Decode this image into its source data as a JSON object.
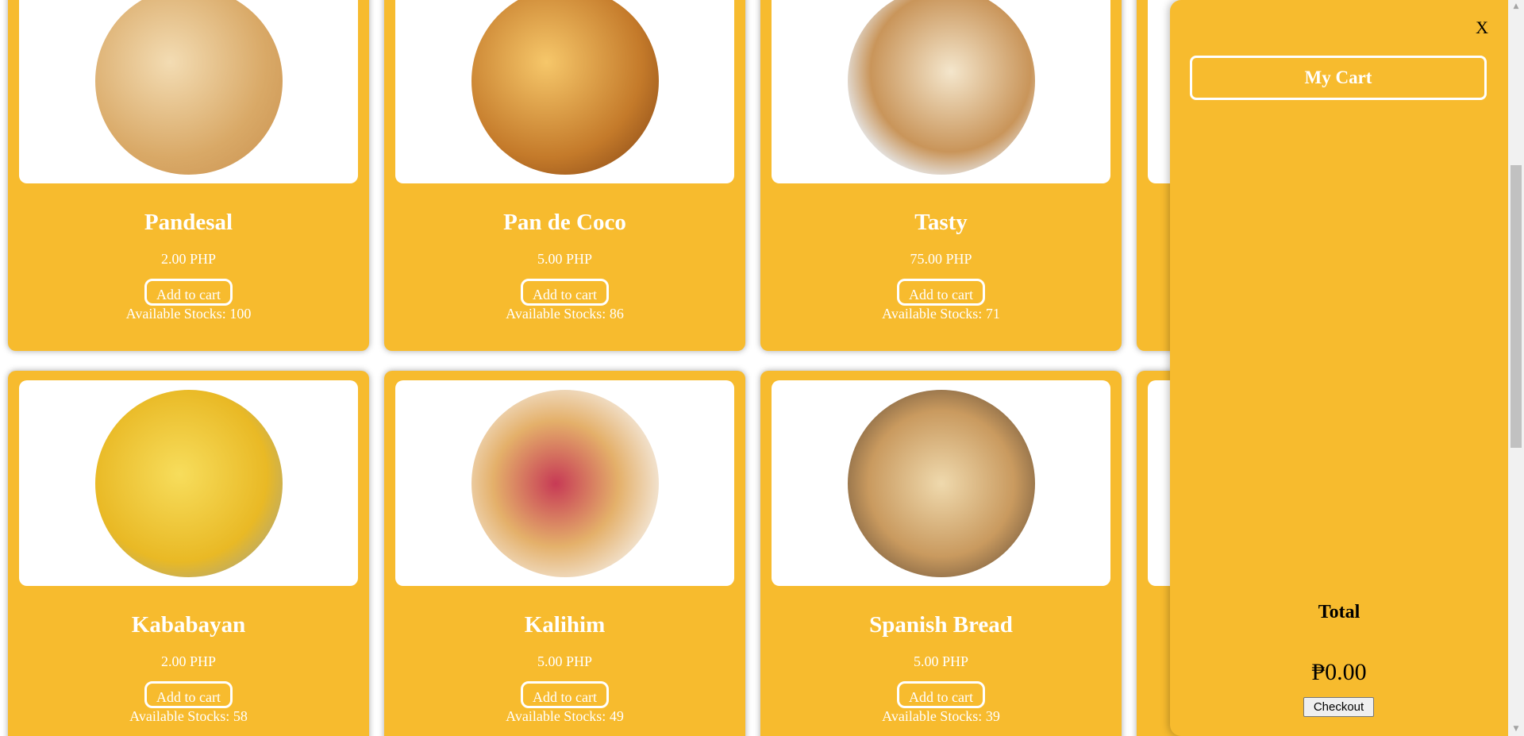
{
  "products": [
    {
      "name": "Pandesal",
      "price": "2.00 PHP",
      "button": "Add to cart",
      "stock": "Available Stocks: 100",
      "image": {
        "label": "pandesal-image",
        "bg": "radial-gradient(circle at 40% 40%, #f3dcb3, #d9a967 60%, #c88f4d)"
      }
    },
    {
      "name": "Pan de Coco",
      "price": "5.00 PHP",
      "button": "Add to cart",
      "stock": "Available Stocks: 86",
      "image": {
        "label": "pan-de-coco-image",
        "bg": "radial-gradient(circle at 40% 40%, #f6c76a, #c47a2a 60%, #7a3d12)"
      }
    },
    {
      "name": "Tasty",
      "price": "75.00 PHP",
      "button": "Add to cart",
      "stock": "Available Stocks: 71",
      "image": {
        "label": "tasty-bread-image",
        "bg": "radial-gradient(circle at 55% 45%, #f4e6cc, #c9955a 55%, #e6e6e6 75%)"
      }
    },
    {
      "name": "",
      "price": "",
      "button": "",
      "stock": "",
      "image": {
        "label": "hidden-product-image",
        "bg": "#ffffff"
      }
    },
    {
      "name": "Kababayan",
      "price": "2.00 PHP",
      "button": "Add to cart",
      "stock": "Available Stocks: 58",
      "image": {
        "label": "kababayan-image",
        "bg": "radial-gradient(circle at 45% 45%, #f7dd5c, #e9b925 60%, #8a9bb0)"
      }
    },
    {
      "name": "Kalihim",
      "price": "5.00 PHP",
      "button": "Add to cart",
      "stock": "Available Stocks: 49",
      "image": {
        "label": "kalihim-image",
        "bg": "radial-gradient(circle at 45% 50%, #c73a55, #e4b06a 45%, #f2e3d0 75%)"
      }
    },
    {
      "name": "Spanish Bread",
      "price": "5.00 PHP",
      "button": "Add to cart",
      "stock": "Available Stocks: 39",
      "image": {
        "label": "spanish-bread-image",
        "bg": "radial-gradient(circle at 50% 50%, #efd9ad, #c99a5f 55%, #4a3a2d)"
      }
    },
    {
      "name": "",
      "price": "",
      "button": "",
      "stock": "",
      "image": {
        "label": "hidden-product-image",
        "bg": "#ffffff"
      }
    }
  ],
  "cart": {
    "close": "X",
    "title": "My Cart",
    "total_label": "Total",
    "total_value": "₱0.00",
    "checkout": "Checkout"
  },
  "scrollbar": {
    "up": "▲",
    "down": "▼"
  }
}
